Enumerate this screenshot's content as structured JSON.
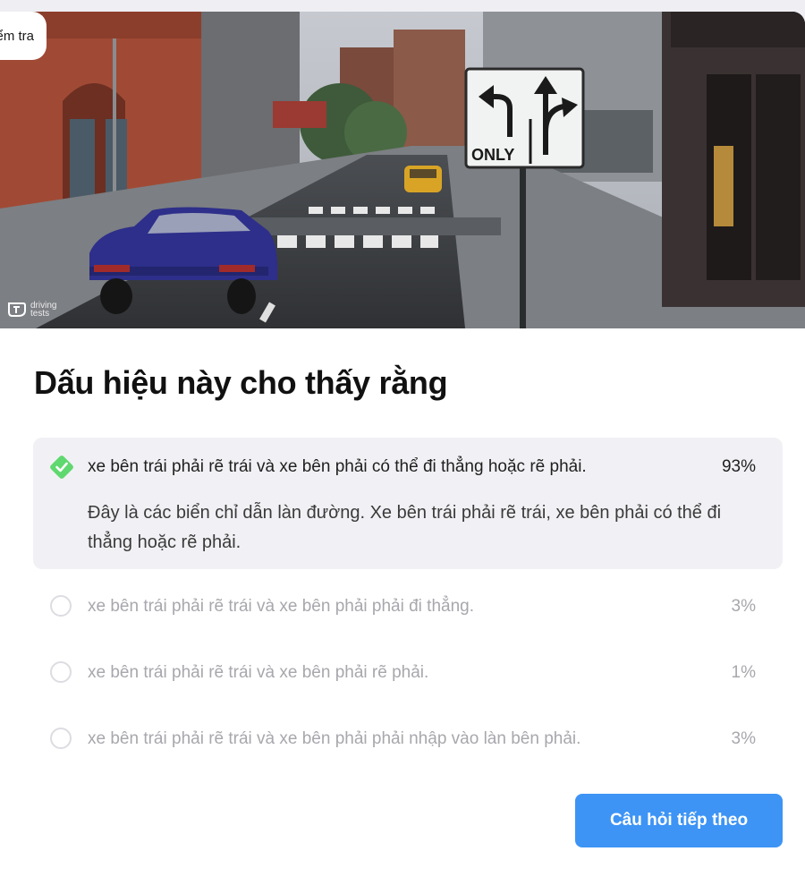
{
  "header": {
    "exit_label": "Kiểm tra"
  },
  "image": {
    "watermark_line1": "driving",
    "watermark_line2": "tests",
    "sign_text": "ONLY"
  },
  "question": {
    "title": "Dấu hiệu này cho thấy rằng"
  },
  "answers": [
    {
      "label": "xe bên trái phải rẽ trái và xe bên phải có thể đi thẳng hoặc rẽ phải.",
      "percent": "93%",
      "correct": true,
      "explanation": "Đây là các biển chỉ dẫn làn đường. Xe bên trái phải rẽ trái, xe bên phải có thể đi thẳng hoặc rẽ phải."
    },
    {
      "label": "xe bên trái phải rẽ trái và xe bên phải phải đi thẳng.",
      "percent": "3%",
      "correct": false
    },
    {
      "label": "xe bên trái phải rẽ trái và xe bên phải rẽ phải.",
      "percent": "1%",
      "correct": false
    },
    {
      "label": "xe bên trái phải rẽ trái và xe bên phải phải nhập vào làn bên phải.",
      "percent": "3%",
      "correct": false
    }
  ],
  "actions": {
    "next_label": "Câu hỏi tiếp theo"
  },
  "colors": {
    "accent": "#3d94f5",
    "correct": "#5fd86f",
    "background": "#eeeef3"
  }
}
